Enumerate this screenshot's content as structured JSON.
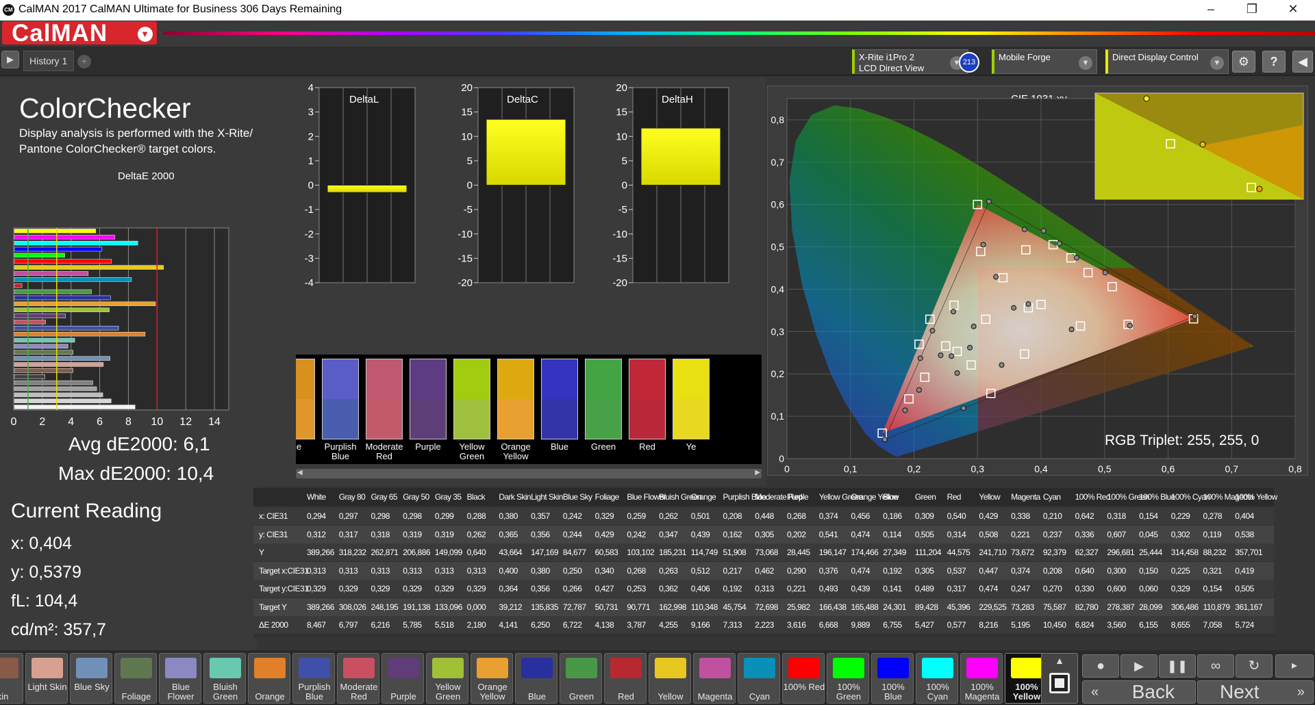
{
  "window": {
    "title": "CalMAN 2017 CalMAN Ultimate for Business 306 Days Remaining",
    "logo_text": "CM"
  },
  "brand": {
    "name": "CalMAN"
  },
  "tabs": {
    "history_label": "History 1",
    "add_label": "+"
  },
  "devices": {
    "meter_line1": "X-Rite i1Pro 2",
    "meter_line2": "LCD Direct View",
    "meter_badge": "213",
    "source": "Mobile Forge",
    "display": "Direct Display Control"
  },
  "left": {
    "title": "ColorChecker",
    "description": "Display analysis is performed with the X-Rite/ Pantone ColorChecker® target colors.",
    "chart_title": "DeltaE 2000",
    "avg": "Avg dE2000: 6,1",
    "max": "Max dE2000: 10,4",
    "x_ticks": [
      "0",
      "2",
      "4",
      "6",
      "8",
      "10",
      "12",
      "14"
    ]
  },
  "reading": {
    "title": "Current Reading",
    "x": "x: 0,404",
    "y": "y: 0,5379",
    "fl": "fL: 104,4",
    "cdm": "cd/m²: 357,7"
  },
  "mini_charts": {
    "deltaL": {
      "title": "DeltaL",
      "ticks": [
        "4",
        "3",
        "2",
        "1",
        "0",
        "-1",
        "-2",
        "-3",
        "-4"
      ]
    },
    "deltaC": {
      "title": "DeltaC",
      "ticks": [
        "20",
        "15",
        "10",
        "5",
        "0",
        "-5",
        "-10",
        "-15",
        "-20"
      ]
    },
    "deltaH": {
      "title": "DeltaH",
      "ticks": [
        "20",
        "15",
        "10",
        "5",
        "0",
        "-5",
        "-10",
        "-15",
        "-20"
      ]
    }
  },
  "swatch_strip": [
    {
      "label": "ge",
      "top": "#d8901e",
      "bottom": "#e0962a"
    },
    {
      "label": "Purplish Blue",
      "top": "#5a5cc8",
      "bottom": "#4a5eb0"
    },
    {
      "label": "Moderate Red",
      "top": "#c05870",
      "bottom": "#c25a6a"
    },
    {
      "label": "Purple",
      "top": "#5e3c84",
      "bottom": "#5e3e78"
    },
    {
      "label": "Yellow Green",
      "top": "#a2cc10",
      "bottom": "#a0c040"
    },
    {
      "label": "Orange Yellow",
      "top": "#dcaa10",
      "bottom": "#e8a030"
    },
    {
      "label": "Blue",
      "top": "#3434c0",
      "bottom": "#3434a8"
    },
    {
      "label": "Green",
      "top": "#44a444",
      "bottom": "#48a048"
    },
    {
      "label": "Red",
      "top": "#c02838",
      "bottom": "#b82838"
    },
    {
      "label": "Ye",
      "top": "#e8e010",
      "bottom": "#e8d820"
    }
  ],
  "cie": {
    "title": "CIE 1931 xy",
    "rgb_triplet": "RGB Triplet: 255, 255, 0",
    "x_ticks": [
      "0",
      "0,1",
      "0,2",
      "0,3",
      "0,4",
      "0,5",
      "0,6",
      "0,7",
      "0,8"
    ],
    "y_ticks": [
      "0,8",
      "0,7",
      "0,6",
      "0,5",
      "0,4",
      "0,3",
      "0,2",
      "0,1",
      "0"
    ]
  },
  "table": {
    "headers": [
      "White",
      "Gray 80",
      "Gray 65",
      "Gray 50",
      "Gray 35",
      "Black",
      "Dark Skin",
      "Light Skin",
      "Blue Sky",
      "Foliage",
      "Blue Flower",
      "Bluish Green",
      "Orange",
      "Purplish Blue",
      "Moderate Red",
      "Purple",
      "Yellow Green",
      "Orange Yellow",
      "Blue",
      "Green",
      "Red",
      "Yellow",
      "Magenta",
      "Cyan",
      "100% Red",
      "100% Green",
      "100% Blue",
      "100% Cyan",
      "100% Magenta",
      "100% Yellow"
    ],
    "rows": [
      {
        "label": "x: CIE31",
        "values": [
          "0,294",
          "0,297",
          "0,298",
          "0,298",
          "0,299",
          "0,288",
          "0,380",
          "0,357",
          "0,242",
          "0,329",
          "0,259",
          "0,262",
          "0,501",
          "0,208",
          "0,448",
          "0,268",
          "0,374",
          "0,456",
          "0,186",
          "0,309",
          "0,540",
          "0,429",
          "0,338",
          "0,210",
          "0,642",
          "0,318",
          "0,154",
          "0,229",
          "0,278",
          "0,404"
        ]
      },
      {
        "label": "y: CIE31",
        "values": [
          "0,312",
          "0,317",
          "0,318",
          "0,319",
          "0,319",
          "0,262",
          "0,365",
          "0,356",
          "0,244",
          "0,429",
          "0,242",
          "0,347",
          "0,439",
          "0,162",
          "0,305",
          "0,202",
          "0,541",
          "0,474",
          "0,114",
          "0,505",
          "0,314",
          "0,508",
          "0,221",
          "0,237",
          "0,336",
          "0,607",
          "0,045",
          "0,302",
          "0,119",
          "0,538"
        ]
      },
      {
        "label": "Y",
        "values": [
          "389,266",
          "318,232",
          "262,871",
          "206,886",
          "149,099",
          "0,640",
          "43,664",
          "147,169",
          "84,677",
          "60,583",
          "103,102",
          "185,231",
          "114,749",
          "51,908",
          "73,068",
          "28,445",
          "196,147",
          "174,466",
          "27,349",
          "111,204",
          "44,575",
          "241,710",
          "73,672",
          "92,379",
          "62,327",
          "296,681",
          "25,444",
          "314,458",
          "88,232",
          "357,701"
        ]
      },
      {
        "label": "Target x:CIE31",
        "values": [
          "0,313",
          "0,313",
          "0,313",
          "0,313",
          "0,313",
          "0,313",
          "0,400",
          "0,380",
          "0,250",
          "0,340",
          "0,268",
          "0,263",
          "0,512",
          "0,217",
          "0,462",
          "0,290",
          "0,376",
          "0,474",
          "0,192",
          "0,305",
          "0,537",
          "0,447",
          "0,374",
          "0,208",
          "0,640",
          "0,300",
          "0,150",
          "0,225",
          "0,321",
          "0,419"
        ]
      },
      {
        "label": "Target y:CIE31",
        "values": [
          "0,329",
          "0,329",
          "0,329",
          "0,329",
          "0,329",
          "0,329",
          "0,364",
          "0,356",
          "0,266",
          "0,427",
          "0,253",
          "0,362",
          "0,406",
          "0,192",
          "0,313",
          "0,221",
          "0,493",
          "0,439",
          "0,141",
          "0,489",
          "0,317",
          "0,474",
          "0,247",
          "0,270",
          "0,330",
          "0,600",
          "0,060",
          "0,329",
          "0,154",
          "0,505"
        ]
      },
      {
        "label": "Target Y",
        "values": [
          "389,266",
          "308,026",
          "248,195",
          "191,138",
          "133,096",
          "0,000",
          "39,212",
          "135,835",
          "72,787",
          "50,731",
          "90,771",
          "162,998",
          "110,348",
          "45,754",
          "72,698",
          "25,982",
          "166,438",
          "165,488",
          "24,301",
          "89,428",
          "45,396",
          "229,525",
          "73,283",
          "75,587",
          "82,780",
          "278,387",
          "28,099",
          "306,486",
          "110,879",
          "361,167"
        ]
      },
      {
        "label": "ΔE 2000",
        "values": [
          "8,467",
          "6,797",
          "6,216",
          "5,785",
          "5,518",
          "2,180",
          "4,141",
          "6,250",
          "6,722",
          "4,138",
          "3,787",
          "4,255",
          "9,166",
          "7,313",
          "2,223",
          "3,616",
          "6,668",
          "9,889",
          "6,755",
          "5,427",
          "0,577",
          "8,216",
          "5,195",
          "10,450",
          "6,824",
          "3,560",
          "6,155",
          "8,655",
          "7,058",
          "5,724"
        ]
      }
    ]
  },
  "bottom_swatches": [
    {
      "label": "kin",
      "color": "#8a5a48"
    },
    {
      "label": "Light Skin",
      "color": "#d8a090"
    },
    {
      "label": "Blue Sky",
      "color": "#7090b8"
    },
    {
      "label": "Foliage",
      "color": "#607850"
    },
    {
      "label": "Blue Flower",
      "color": "#8c88c4"
    },
    {
      "label": "Bluish Green",
      "color": "#68c8b0"
    },
    {
      "label": "Orange",
      "color": "#e08028"
    },
    {
      "label": "Purplish Blue",
      "color": "#4050a8"
    },
    {
      "label": "Moderate Red",
      "color": "#c85060"
    },
    {
      "label": "Purple",
      "color": "#603c78"
    },
    {
      "label": "Yellow Green",
      "color": "#a0c038"
    },
    {
      "label": "Orange Yellow",
      "color": "#e8a030"
    },
    {
      "label": "Blue",
      "color": "#2830a0"
    },
    {
      "label": "Green",
      "color": "#489848"
    },
    {
      "label": "Red",
      "color": "#b82830"
    },
    {
      "label": "Yellow",
      "color": "#e8c820"
    },
    {
      "label": "Magenta",
      "color": "#c050a0"
    },
    {
      "label": "Cyan",
      "color": "#0890b8"
    },
    {
      "label": "100% Red",
      "color": "#ff0000"
    },
    {
      "label": "100% Green",
      "color": "#00ff00"
    },
    {
      "label": "100% Blue",
      "color": "#0000ff"
    },
    {
      "label": "100% Cyan",
      "color": "#00ffff"
    },
    {
      "label": "100% Magenta",
      "color": "#ff00ff"
    },
    {
      "label": "100% Yellow",
      "color": "#ffff00"
    }
  ],
  "controls": {
    "back": "Back",
    "next": "Next"
  },
  "chart_data": [
    {
      "type": "bar",
      "title": "DeltaE 2000",
      "orientation": "horizontal",
      "categories": [
        "White",
        "Gray 80",
        "Gray 65",
        "Gray 50",
        "Gray 35",
        "Black",
        "Dark Skin",
        "Light Skin",
        "Blue Sky",
        "Foliage",
        "Blue Flower",
        "Bluish Green",
        "Orange",
        "Purplish Blue",
        "Moderate Red",
        "Purple",
        "Yellow Green",
        "Orange Yellow",
        "Blue",
        "Green",
        "Red",
        "Yellow",
        "Magenta",
        "Cyan",
        "100% Red",
        "100% Green",
        "100% Blue",
        "100% Cyan",
        "100% Magenta",
        "100% Yellow"
      ],
      "values": [
        8.467,
        6.797,
        6.216,
        5.785,
        5.518,
        2.18,
        4.141,
        6.25,
        6.722,
        4.138,
        3.787,
        4.255,
        9.166,
        7.313,
        2.223,
        3.616,
        6.668,
        9.889,
        6.755,
        5.427,
        0.577,
        8.216,
        5.195,
        10.45,
        6.824,
        3.56,
        6.155,
        8.655,
        7.058,
        5.724
      ],
      "xlim": [
        0,
        15
      ],
      "bar_colors": [
        "#ffff00",
        "#ff00ff",
        "#00ffff",
        "#0000ff",
        "#00ff00",
        "#ff0000",
        "#e8c820",
        "#c050a0",
        "#0890b8",
        "#b82830",
        "#489848",
        "#2830a0",
        "#e8a030",
        "#a0c038",
        "#603c78",
        "#c85060",
        "#4050a8",
        "#e08028",
        "#68c8b0",
        "#8c88c4",
        "#607850",
        "#7090b8",
        "#d8a090",
        "#8a5a48",
        "#404040",
        "#808080",
        "#a0a0a0",
        "#bdbdbd",
        "#d6d6d6",
        "#f4f4f4"
      ]
    },
    {
      "type": "bar",
      "title": "DeltaL",
      "values": [
        -0.3
      ],
      "ylim": [
        -4,
        4
      ]
    },
    {
      "type": "bar",
      "title": "DeltaC",
      "values": [
        13.5
      ],
      "ylim": [
        -20,
        20
      ]
    },
    {
      "type": "bar",
      "title": "DeltaH",
      "values": [
        11.7
      ],
      "ylim": [
        -20,
        20
      ]
    },
    {
      "type": "scatter",
      "title": "CIE 1931 xy",
      "xlim": [
        0,
        0.8
      ],
      "ylim": [
        0,
        0.85
      ],
      "measured": [
        {
          "x": 0.294,
          "y": 0.312
        },
        {
          "x": 0.288,
          "y": 0.262
        },
        {
          "x": 0.38,
          "y": 0.365
        },
        {
          "x": 0.357,
          "y": 0.356
        },
        {
          "x": 0.242,
          "y": 0.244
        },
        {
          "x": 0.329,
          "y": 0.429
        },
        {
          "x": 0.259,
          "y": 0.242
        },
        {
          "x": 0.262,
          "y": 0.347
        },
        {
          "x": 0.501,
          "y": 0.439
        },
        {
          "x": 0.208,
          "y": 0.162
        },
        {
          "x": 0.448,
          "y": 0.305
        },
        {
          "x": 0.268,
          "y": 0.202
        },
        {
          "x": 0.374,
          "y": 0.541
        },
        {
          "x": 0.456,
          "y": 0.474
        },
        {
          "x": 0.186,
          "y": 0.114
        },
        {
          "x": 0.309,
          "y": 0.505
        },
        {
          "x": 0.54,
          "y": 0.314
        },
        {
          "x": 0.429,
          "y": 0.508
        },
        {
          "x": 0.338,
          "y": 0.221
        },
        {
          "x": 0.21,
          "y": 0.237
        },
        {
          "x": 0.642,
          "y": 0.336
        },
        {
          "x": 0.318,
          "y": 0.607
        },
        {
          "x": 0.154,
          "y": 0.045
        },
        {
          "x": 0.229,
          "y": 0.302
        },
        {
          "x": 0.278,
          "y": 0.119
        },
        {
          "x": 0.404,
          "y": 0.538
        }
      ],
      "targets": [
        {
          "x": 0.313,
          "y": 0.329
        },
        {
          "x": 0.4,
          "y": 0.364
        },
        {
          "x": 0.38,
          "y": 0.356
        },
        {
          "x": 0.25,
          "y": 0.266
        },
        {
          "x": 0.34,
          "y": 0.427
        },
        {
          "x": 0.268,
          "y": 0.253
        },
        {
          "x": 0.263,
          "y": 0.362
        },
        {
          "x": 0.512,
          "y": 0.406
        },
        {
          "x": 0.217,
          "y": 0.192
        },
        {
          "x": 0.462,
          "y": 0.313
        },
        {
          "x": 0.29,
          "y": 0.221
        },
        {
          "x": 0.376,
          "y": 0.493
        },
        {
          "x": 0.474,
          "y": 0.439
        },
        {
          "x": 0.192,
          "y": 0.141
        },
        {
          "x": 0.305,
          "y": 0.489
        },
        {
          "x": 0.537,
          "y": 0.317
        },
        {
          "x": 0.447,
          "y": 0.474
        },
        {
          "x": 0.374,
          "y": 0.247
        },
        {
          "x": 0.208,
          "y": 0.27
        },
        {
          "x": 0.64,
          "y": 0.33
        },
        {
          "x": 0.3,
          "y": 0.6
        },
        {
          "x": 0.15,
          "y": 0.06
        },
        {
          "x": 0.225,
          "y": 0.329
        },
        {
          "x": 0.321,
          "y": 0.154
        },
        {
          "x": 0.419,
          "y": 0.505
        }
      ]
    }
  ]
}
